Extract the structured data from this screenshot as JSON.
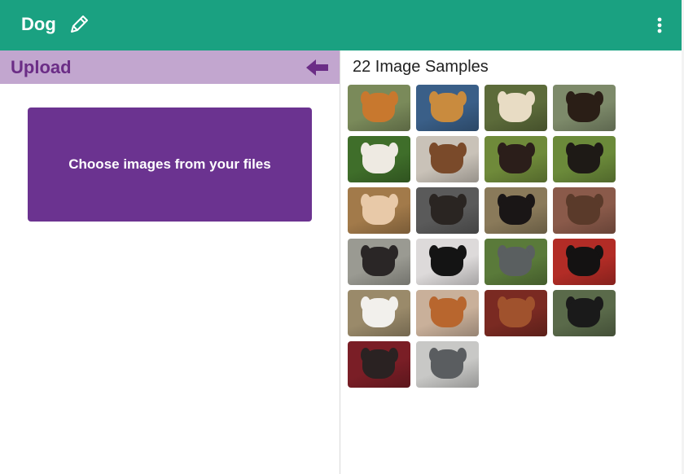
{
  "header": {
    "title": "Dog",
    "accent": "#1aa181"
  },
  "left": {
    "upload_label": "Upload",
    "choose_button_label": "Choose images from your files",
    "accent": "#6b3390"
  },
  "right": {
    "samples_title": "22 Image Samples",
    "thumbnails": [
      {
        "bg": "#7a8a5a",
        "fur": "#c8782e"
      },
      {
        "bg": "#3a5f88",
        "fur": "#c98b3e"
      },
      {
        "bg": "#5c6b3a",
        "fur": "#e8dcc4"
      },
      {
        "bg": "#7d8a6a",
        "fur": "#2a1e16"
      },
      {
        "bg": "#3f6e2a",
        "fur": "#eeeae2"
      },
      {
        "bg": "#c9c2b8",
        "fur": "#7a4a2a"
      },
      {
        "bg": "#6f8a3a",
        "fur": "#2b1e1a"
      },
      {
        "bg": "#6b8a3a",
        "fur": "#1e1a16"
      },
      {
        "bg": "#a27a4a",
        "fur": "#e8c9a8"
      },
      {
        "bg": "#5a5a5a",
        "fur": "#2a2522"
      },
      {
        "bg": "#8a7a5a",
        "fur": "#1a1616"
      },
      {
        "bg": "#8a5a4a",
        "fur": "#5a3a2a"
      },
      {
        "bg": "#9a9a92",
        "fur": "#2a2626"
      },
      {
        "bg": "#dddada",
        "fur": "#141414"
      },
      {
        "bg": "#5a7a3a",
        "fur": "#5a5f60"
      },
      {
        "bg": "#b22c26",
        "fur": "#141212"
      },
      {
        "bg": "#9a8a6a",
        "fur": "#f2f0ec"
      },
      {
        "bg": "#c9b09a",
        "fur": "#b8662e"
      },
      {
        "bg": "#7a2a22",
        "fur": "#a0522d"
      },
      {
        "bg": "#5a6a4a",
        "fur": "#1a1a1a"
      },
      {
        "bg": "#7a1e26",
        "fur": "#2a2222"
      },
      {
        "bg": "#c8c8c6",
        "fur": "#5a5d60"
      }
    ]
  }
}
